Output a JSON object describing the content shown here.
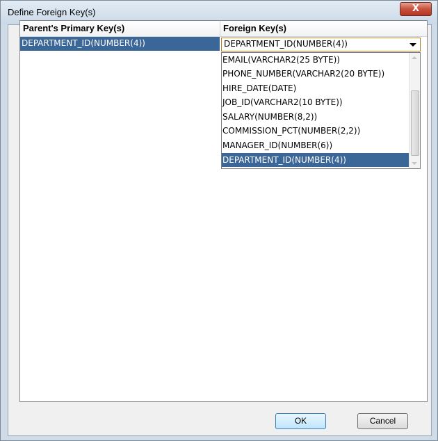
{
  "window": {
    "title": "Define Foreign Key(s)",
    "close_label": "X"
  },
  "table": {
    "headers": [
      "Parent's Primary Key(s)",
      "Foreign Key(s)"
    ],
    "parent_key": "DEPARTMENT_ID(NUMBER(4))",
    "foreign_key_selected": "DEPARTMENT_ID(NUMBER(4))"
  },
  "dropdown": {
    "options": [
      "EMAIL(VARCHAR2(25 BYTE))",
      "PHONE_NUMBER(VARCHAR2(20 BYTE))",
      "HIRE_DATE(DATE)",
      "JOB_ID(VARCHAR2(10 BYTE))",
      "SALARY(NUMBER(8,2))",
      "COMMISSION_PCT(NUMBER(2,2))",
      "MANAGER_ID(NUMBER(6))",
      "DEPARTMENT_ID(NUMBER(4))"
    ],
    "selected_index": 7
  },
  "buttons": {
    "ok": "OK",
    "cancel": "Cancel"
  }
}
